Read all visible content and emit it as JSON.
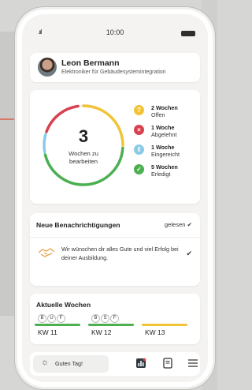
{
  "statusbar": {
    "signal": ".ııl",
    "time": "10:00"
  },
  "profile": {
    "name": "Leon Bermann",
    "role": "Elektroniker für Gebäudesystemintegration"
  },
  "summary": {
    "count": "3",
    "label": "Wochen zu bearbeiten",
    "legend": [
      {
        "value": "2 Wochen",
        "label": "Offen",
        "color": "#f2c337",
        "icon": "question-icon",
        "glyph": "?"
      },
      {
        "value": "1 Woche",
        "label": "Abgelehnt",
        "color": "#d84250",
        "icon": "x-icon",
        "glyph": "×"
      },
      {
        "value": "1 Woche",
        "label": "Eingereicht",
        "color": "#8ccbe6",
        "icon": "pause-icon",
        "glyph": "‖"
      },
      {
        "value": "5 Wochen",
        "label": "Erledigt",
        "color": "#4caf50",
        "icon": "check-icon",
        "glyph": "✓"
      }
    ]
  },
  "notifications": {
    "title": "Neue Benachrichtigungen",
    "read_label": "gelesen ✔",
    "item_text": "Wir wünschen dir alles Gute und viel Erfolg bei deiner Ausbildung.",
    "item_icon": "handshake-icon"
  },
  "weeks": {
    "title": "Aktuelle Wochen",
    "items": [
      {
        "letters": [
          "B",
          "U",
          "F"
        ],
        "label": "KW 11",
        "color": "#4caf50"
      },
      {
        "letters": [
          "B",
          "S",
          "F"
        ],
        "label": "KW 12",
        "color": "#4caf50"
      },
      {
        "letters": [],
        "label": "KW 13",
        "color": "#f2c337"
      }
    ]
  },
  "navbar": {
    "greet_label": "Guten Tag!",
    "greet_icon": "sun-icon"
  }
}
